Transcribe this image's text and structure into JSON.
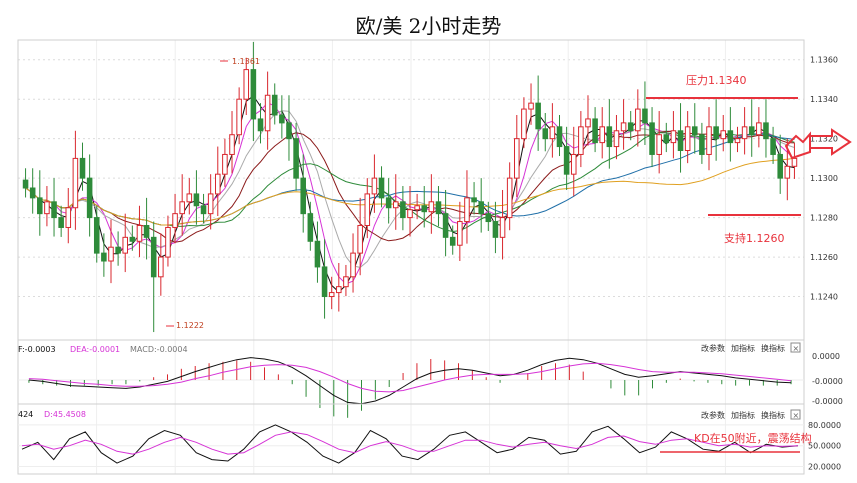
{
  "title": "欧/美 2小时走势",
  "colors": {
    "up": "#d9272e",
    "down": "#2e8b3a",
    "grid": "#dcdcdc",
    "annotation": "#e8323c",
    "ma": [
      "#111111",
      "#d633d6",
      "#aaaaaa",
      "#8b1a1a",
      "#2e8b3a",
      "#1f6fa8",
      "#e0a020"
    ]
  },
  "panel_buttons": [
    "改参数",
    "加指标",
    "换指标"
  ],
  "macd_label": {
    "dif": "F:-0.0003",
    "dea": "DEA:-0.0001",
    "macd": "MACD:-0.0004"
  },
  "kd_label": {
    "k": "424",
    "d": "D:45.4508"
  },
  "annotations": {
    "resistance": "压力1.1340",
    "support": "支持1.1260",
    "kd_note": "KD在50附近，震荡结构",
    "high_mark": "1.1361",
    "low_mark": "1.1222"
  },
  "chart_data": [
    {
      "type": "candlestick",
      "title": "欧/美 2小时走势",
      "ylim": [
        1.122,
        1.137
      ],
      "y_ticks": [
        "1.1360",
        "1.1340",
        "1.1320",
        "1.1300",
        "1.1280",
        "1.1260",
        "1.1240"
      ],
      "resistance": 1.134,
      "support": 1.128,
      "closes": [
        1.1295,
        1.129,
        1.1282,
        1.1288,
        1.128,
        1.1275,
        1.1285,
        1.131,
        1.13,
        1.128,
        1.1262,
        1.1258,
        1.1265,
        1.1262,
        1.127,
        1.1268,
        1.1276,
        1.127,
        1.125,
        1.126,
        1.1275,
        1.1282,
        1.1288,
        1.1292,
        1.1286,
        1.1282,
        1.1292,
        1.1302,
        1.1312,
        1.1322,
        1.134,
        1.1355,
        1.133,
        1.1324,
        1.1342,
        1.1332,
        1.1328,
        1.132,
        1.13,
        1.1282,
        1.1268,
        1.1255,
        1.124,
        1.1242,
        1.1245,
        1.125,
        1.1262,
        1.1276,
        1.1292,
        1.13,
        1.129,
        1.1285,
        1.1288,
        1.128,
        1.1284,
        1.1286,
        1.1283,
        1.1288,
        1.1282,
        1.127,
        1.1266,
        1.1278,
        1.129,
        1.1288,
        1.1282,
        1.1278,
        1.127,
        1.128,
        1.13,
        1.132,
        1.1335,
        1.1338,
        1.1325,
        1.132,
        1.1326,
        1.1316,
        1.1302,
        1.1312,
        1.1326,
        1.133,
        1.1318,
        1.1326,
        1.1316,
        1.1324,
        1.1328,
        1.1324,
        1.1335,
        1.1328,
        1.1312,
        1.1322,
        1.1318,
        1.1324,
        1.1314,
        1.1326,
        1.1322,
        1.1312,
        1.1326,
        1.132,
        1.1324,
        1.1318,
        1.132,
        1.1326,
        1.1322,
        1.1328,
        1.132,
        1.1312,
        1.13,
        1.1306,
        1.131
      ]
    },
    {
      "type": "bar",
      "title": "MACD",
      "y_ticks": [
        "0.0000",
        "-0.0000",
        "-0.0000"
      ],
      "dif": [
        0,
        -0.2,
        -0.5,
        -0.8,
        -0.9,
        -1.0,
        -1.1,
        -1.2,
        -1.0,
        -0.6,
        -0.2,
        0.5,
        1.2,
        1.8,
        2.4,
        2.9,
        3.2,
        3.0,
        2.6,
        1.8,
        0.6,
        -0.8,
        -2.2,
        -3.2,
        -3.4,
        -3.0,
        -2.2,
        -1.0,
        0.2,
        1.0,
        1.4,
        1.6,
        1.4,
        1.0,
        0.6,
        0.8,
        1.4,
        2.2,
        2.8,
        3.1,
        2.9,
        2.4,
        1.6,
        0.8,
        0.4,
        0.6,
        0.9,
        1.2,
        1.0,
        0.8,
        0.6,
        0.3,
        0.1,
        -0.1,
        -0.3,
        -0.4
      ],
      "dea": [
        0.2,
        0.1,
        -0.1,
        -0.3,
        -0.5,
        -0.6,
        -0.8,
        -0.9,
        -0.9,
        -0.8,
        -0.6,
        -0.3,
        0.2,
        0.6,
        1.1,
        1.5,
        1.9,
        2.1,
        2.2,
        2.1,
        1.8,
        1.2,
        0.4,
        -0.5,
        -1.2,
        -1.6,
        -1.7,
        -1.5,
        -1.0,
        -0.5,
        0,
        0.4,
        0.7,
        0.8,
        0.8,
        0.8,
        0.9,
        1.2,
        1.6,
        2.0,
        2.3,
        2.4,
        2.2,
        1.9,
        1.5,
        1.2,
        1.1,
        1.1,
        1.1,
        1.0,
        0.9,
        0.7,
        0.5,
        0.3,
        0.1,
        -0.1
      ]
    },
    {
      "type": "line",
      "title": "KD",
      "y_ticks": [
        "80.0000",
        "50.0000",
        "20.0000"
      ],
      "ylim": [
        15,
        90
      ],
      "k": [
        45,
        55,
        30,
        60,
        70,
        40,
        25,
        35,
        60,
        72,
        65,
        40,
        30,
        28,
        45,
        70,
        80,
        70,
        55,
        35,
        25,
        40,
        72,
        60,
        35,
        30,
        45,
        65,
        70,
        55,
        40,
        45,
        62,
        58,
        38,
        42,
        70,
        78,
        60,
        40,
        48,
        70,
        60,
        45,
        42,
        55,
        40,
        52,
        48,
        50
      ],
      "d": [
        50,
        52,
        45,
        50,
        58,
        52,
        42,
        38,
        45,
        55,
        62,
        55,
        45,
        38,
        40,
        52,
        65,
        70,
        66,
        56,
        45,
        40,
        50,
        56,
        50,
        42,
        42,
        50,
        58,
        58,
        52,
        48,
        52,
        55,
        50,
        46,
        52,
        62,
        64,
        56,
        52,
        58,
        60,
        55,
        50,
        52,
        48,
        50,
        49,
        50
      ]
    }
  ]
}
